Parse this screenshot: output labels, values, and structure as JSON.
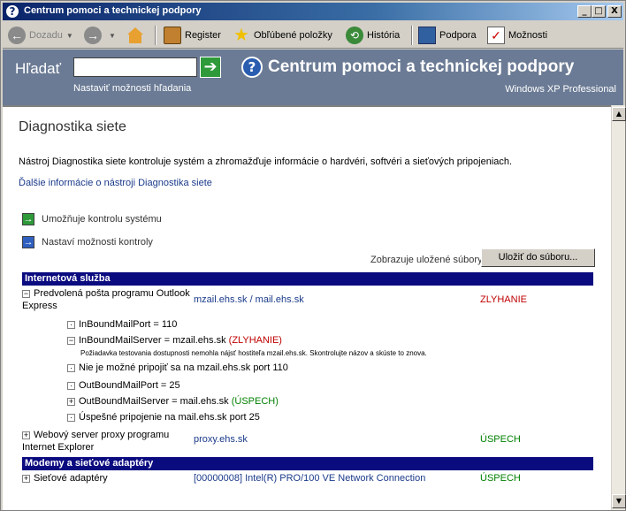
{
  "window": {
    "title": "Centrum pomoci a technickej podpory",
    "controls": {
      "minimize": "_",
      "maximize": "□",
      "close": "X"
    }
  },
  "toolbar": {
    "back_label": "Dozadu",
    "register_label": "Register",
    "favorites_label": "Obľúbené položky",
    "history_label": "História",
    "support_label": "Podpora",
    "options_label": "Možnosti"
  },
  "header": {
    "search_label": "Hľadať",
    "search_value": "",
    "search_options": "Nastaviť možnosti hľadania",
    "title": "Centrum pomoci a technickej podpory",
    "subtitle": "Windows XP Professional"
  },
  "page": {
    "title": "Diagnostika siete",
    "intro": "Nástroj Diagnostika siete kontroluje systém a zhromažďuje informácie o hardvéri, softvéri a sieťových pripojeniach.",
    "more_info": "Ďalšie informácie o nástroji Diagnostika siete",
    "action_scan": "Umožňuje kontrolu systému",
    "action_options": "Nastaví možnosti kontroly",
    "saved_files_label": "Zobrazuje uložené súbory",
    "save_button": "Uložiť do súboru..."
  },
  "sections": {
    "internet": {
      "header": "Internetová služba",
      "mail": {
        "name_line1": "Predvolená pošta programu Outlook",
        "name_line2": "Express",
        "value": "mzail.ehs.sk / mail.ehs.sk",
        "status": "ZLYHANIE",
        "details": {
          "inbound_port": "InBoundMailPort = 110",
          "inbound_server": "InBoundMailServer = mzail.ehs.sk",
          "inbound_server_status": "(ZLYHANIE)",
          "inbound_note": "Požiadavka testovania dostupnosti nemohla nájsť hostiteľa mzail.ehs.sk. Skontrolujte názov a skúste to znova.",
          "connect_fail": "Nie je možné pripojiť sa na mzail.ehs.sk port 110",
          "outbound_port": "OutBoundMailPort = 25",
          "outbound_server": "OutBoundMailServer = mail.ehs.sk",
          "outbound_server_status": "(ÚSPECH)",
          "connect_ok": "Úspešné pripojenie na mail.ehs.sk port 25"
        }
      },
      "proxy": {
        "name_line1": "Webový server proxy programu",
        "name_line2": "Internet Explorer",
        "value": "proxy.ehs.sk",
        "status": "ÚSPECH"
      }
    },
    "adapters": {
      "header": "Modemy a sieťové adaptéry",
      "network": {
        "name": "Sieťové adaptéry",
        "value": "[00000008] Intel(R) PRO/100 VE Network Connection",
        "status": "ÚSPECH"
      }
    }
  },
  "colors": {
    "section_bar": "#0b0b80",
    "header_band": "#6b7b95",
    "fail": "#c00000",
    "ok": "#008000",
    "link": "#1a3a8a"
  }
}
